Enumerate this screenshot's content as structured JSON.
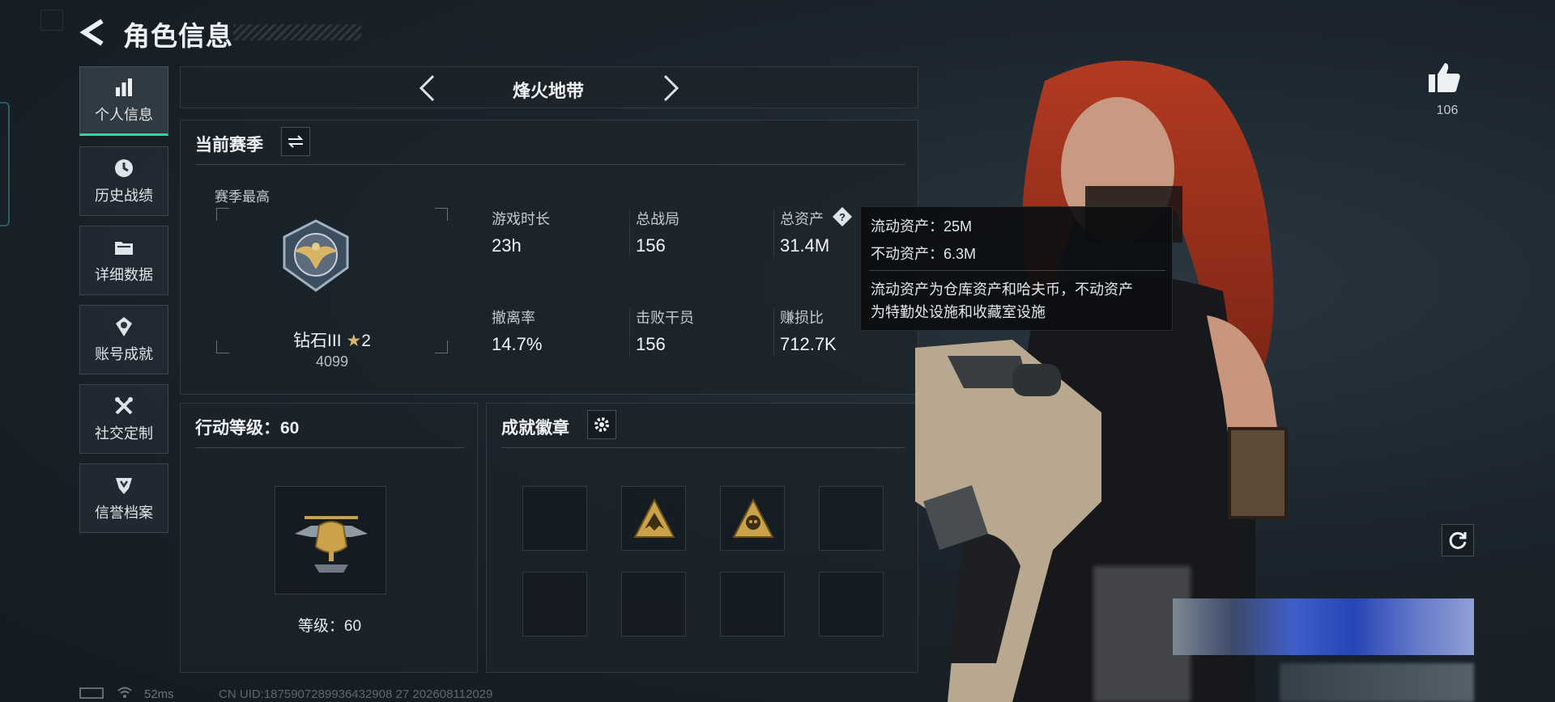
{
  "header": {
    "title": "角色信息"
  },
  "sidebar": {
    "items": [
      {
        "label": "个人信息",
        "icon": "bar-chart-icon",
        "active": true
      },
      {
        "label": "历史战绩",
        "icon": "clock-icon",
        "active": false
      },
      {
        "label": "详细数据",
        "icon": "folder-icon",
        "active": false
      },
      {
        "label": "账号成就",
        "icon": "medal-icon",
        "active": false
      },
      {
        "label": "社交定制",
        "icon": "tools-icon",
        "active": false
      },
      {
        "label": "信誉档案",
        "icon": "credit-icon",
        "active": false
      }
    ]
  },
  "mode_selector": {
    "label": "烽火地带"
  },
  "season": {
    "title": "当前赛季",
    "best_label": "赛季最高",
    "rank_name": "钻石III",
    "rank_stars": "2",
    "rank_score": "4099",
    "stats": [
      {
        "label": "游戏时长",
        "value": "23h"
      },
      {
        "label": "总战局",
        "value": "156"
      },
      {
        "label": "总资产",
        "value": "31.4M"
      },
      {
        "label": "撤离率",
        "value": "14.7%"
      },
      {
        "label": "击败干员",
        "value": "156"
      },
      {
        "label": "赚损比",
        "value": "712.7K"
      }
    ]
  },
  "tooltip": {
    "line1": "流动资产：25M",
    "line2": "不动资产：6.3M",
    "desc1": "流动资产为仓库资产和哈夫币，不动资产",
    "desc2": "为特勤处设施和收藏室设施"
  },
  "action_level": {
    "title": "行动等级：60",
    "level_label": "等级：60"
  },
  "badges": {
    "title": "成就徽章",
    "slots": [
      "empty",
      "badge-eagle",
      "badge-skull",
      "empty",
      "empty",
      "empty",
      "empty",
      "empty"
    ]
  },
  "likes": {
    "count": "106"
  },
  "status_bar": {
    "ping": "52ms",
    "uid": "CN UID:1875907289936432908 27 202608112029"
  },
  "colors": {
    "accent": "#36d3a0",
    "background": "#1b242c",
    "gold": "#c9a24a"
  }
}
